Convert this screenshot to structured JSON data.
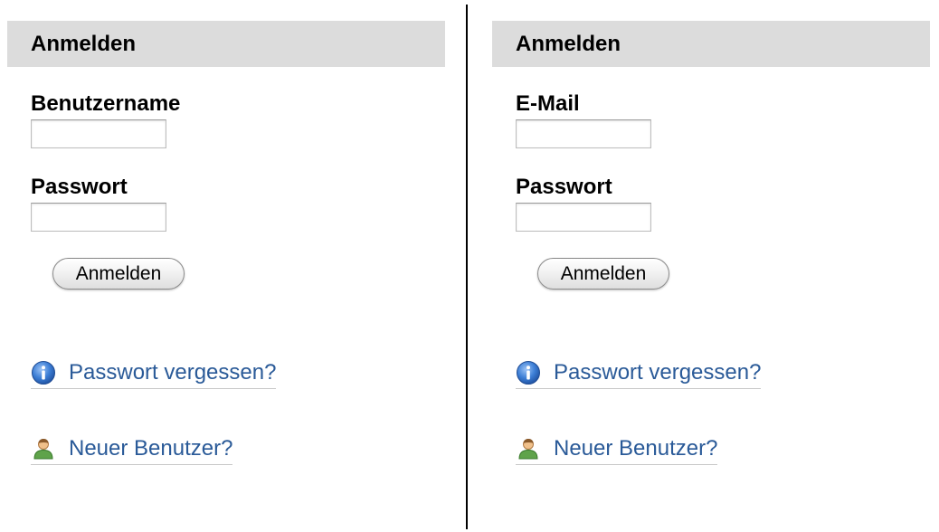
{
  "left_panel": {
    "header": "Anmelden",
    "field1_label": "Benutzername",
    "field1_value": "",
    "field2_label": "Passwort",
    "field2_value": "",
    "button_label": "Anmelden",
    "forgot_icon": "info-icon",
    "forgot_link": "Passwort vergessen?",
    "newuser_icon": "user-icon",
    "newuser_link": "Neuer Benutzer?"
  },
  "right_panel": {
    "header": "Anmelden",
    "field1_label": "E-Mail",
    "field1_value": "",
    "field2_label": "Passwort",
    "field2_value": "",
    "button_label": "Anmelden",
    "forgot_icon": "info-icon",
    "forgot_link": "Passwort vergessen?",
    "newuser_icon": "user-icon",
    "newuser_link": "Neuer Benutzer?"
  },
  "colors": {
    "header_background": "#dcdcdc",
    "link": "#2a5a98",
    "divider": "#000000"
  }
}
